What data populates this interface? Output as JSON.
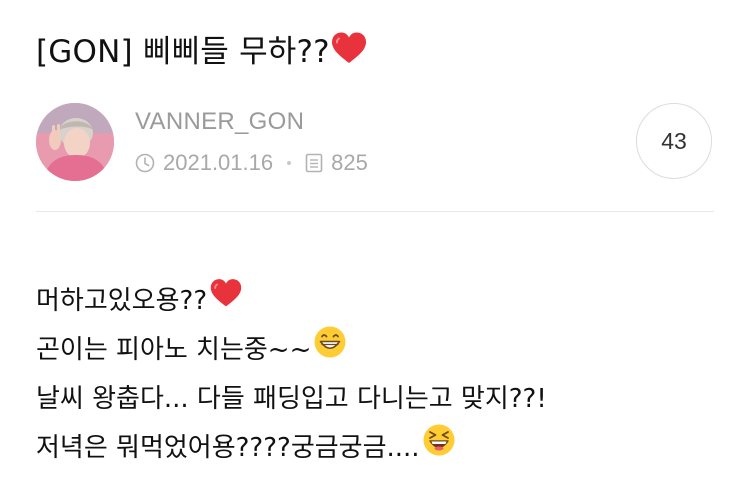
{
  "post": {
    "title": "[GON] 삐삐들 무하??",
    "title_emoji": "heart-emoji",
    "author": "VANNER_GON",
    "date": "2021.01.16",
    "views": "825",
    "comment_count": "43"
  },
  "content": {
    "lines": [
      {
        "text": "머하고있오용??",
        "emoji": "heart-emoji"
      },
      {
        "text": "곤이는 피아노 치는중~~",
        "emoji": "grinning-face-emoji"
      },
      {
        "text": "날씨 왕춥다... 다들 패딩입고 다니는고 맞지??!",
        "emoji": ""
      },
      {
        "text": "저녁은 뭐먹었어용????궁금궁금....",
        "emoji": "laughing-face-emoji"
      }
    ]
  },
  "colors": {
    "text": "#111111",
    "meta": "#9a9a9a",
    "divider": "#e9e9e9",
    "heart": "#e8323c",
    "emoji_face": "#ffcc33"
  }
}
